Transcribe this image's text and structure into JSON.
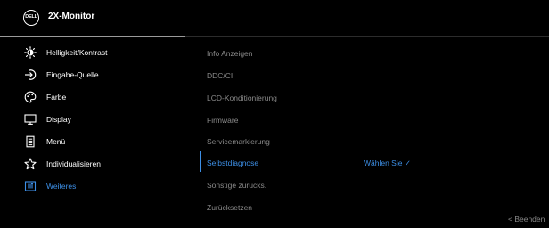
{
  "header": {
    "logo_text": "DELL",
    "title": "2X-Monitor"
  },
  "menu": {
    "items": [
      {
        "label": "Helligkeit/Kontrast",
        "icon": "brightness-icon"
      },
      {
        "label": "Eingabe-Quelle",
        "icon": "input-source-icon"
      },
      {
        "label": "Farbe",
        "icon": "color-palette-icon"
      },
      {
        "label": "Display",
        "icon": "display-icon"
      },
      {
        "label": "Menü",
        "icon": "menu-document-icon"
      },
      {
        "label": "Individualisieren",
        "icon": "star-icon"
      },
      {
        "label": "Weiteres",
        "icon": "others-icon",
        "active": true
      }
    ]
  },
  "submenu": {
    "items": [
      {
        "label": "Info Anzeigen"
      },
      {
        "label": "DDC/CI"
      },
      {
        "label": "LCD-Konditionierung"
      },
      {
        "label": "Firmware"
      },
      {
        "label": "Servicemarkierung"
      },
      {
        "label": "Selbstdiagnose",
        "active": true
      },
      {
        "label": "Sonstige zurücks."
      },
      {
        "label": "Zurücksetzen"
      }
    ],
    "selected_value": "Wählen Sie ✓"
  },
  "footer": {
    "back_label": "< Beenden"
  },
  "colors": {
    "accent": "#3d8fe6",
    "inactive_text": "#8a8a8a",
    "background": "#000000"
  }
}
